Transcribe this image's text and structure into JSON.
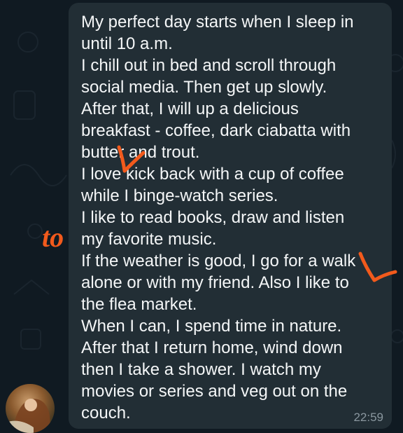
{
  "message": {
    "lines": [
      "My perfect day starts when I sleep in",
      "until 10 a.m.",
      "I chill out in bed and scroll through",
      "social media. Then get up slowly.",
      "After that, I will up a delicious",
      "breakfast - coffee, dark ciabatta with",
      "butter and trout.",
      "I love kick back with a cup of coffee",
      "while I binge-watch series.",
      "I like to read books, draw and listen",
      "my favorite music.",
      "If the weather is good, I go for a walk",
      "alone or with my friend. Also I like to",
      "the flea market.",
      "When I can, I spend time in nature.",
      "After that I return home, wind down",
      "then I take a shower. I watch my",
      "movies or series and veg out on the",
      "couch."
    ],
    "time": "22:59"
  },
  "annotations": {
    "handwritten_word": "to",
    "color": "#f25a1c"
  },
  "colors": {
    "background": "#101a22",
    "bubble": "#222e35",
    "text": "#f4f6f7",
    "timestamp": "#8a979f"
  }
}
